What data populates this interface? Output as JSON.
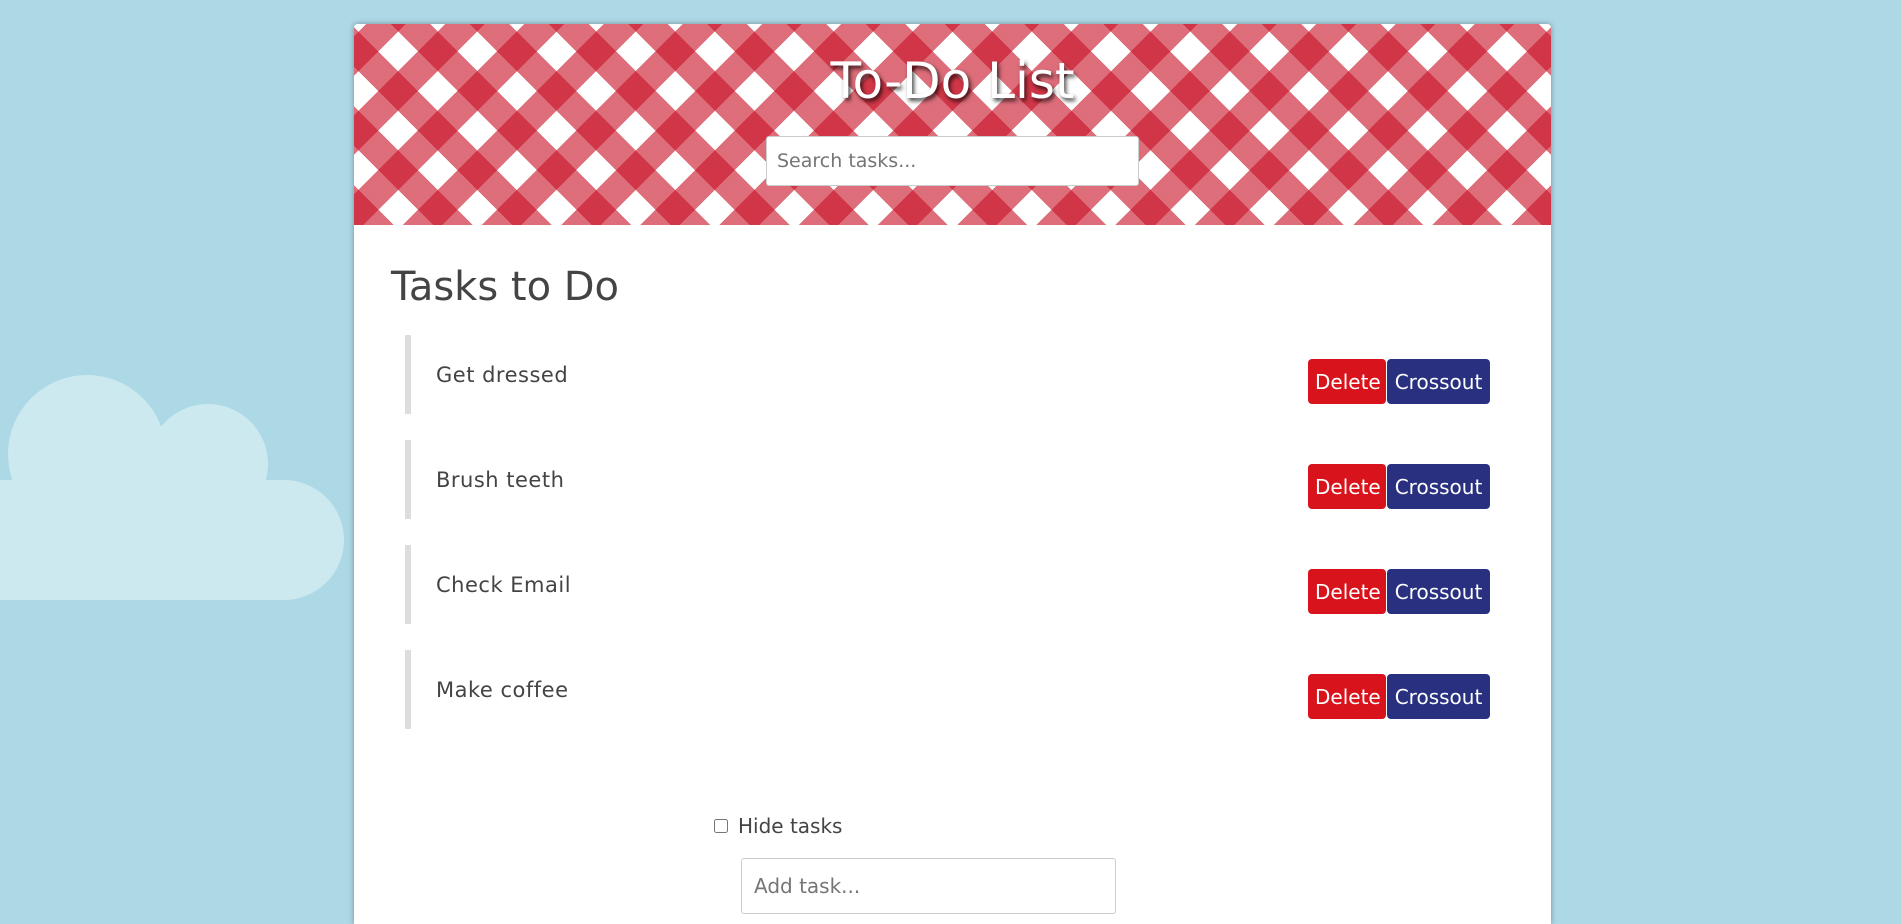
{
  "header": {
    "title": "To-Do List",
    "search_placeholder": "Search tasks..."
  },
  "main": {
    "heading": "Tasks to Do",
    "tasks": [
      {
        "name": "Get dressed",
        "delete_label": "Delete",
        "crossout_label": "Crossout"
      },
      {
        "name": "Brush teeth",
        "delete_label": "Delete",
        "crossout_label": "Crossout"
      },
      {
        "name": "Check Email",
        "delete_label": "Delete",
        "crossout_label": "Crossout"
      },
      {
        "name": "Make coffee",
        "delete_label": "Delete",
        "crossout_label": "Crossout"
      }
    ],
    "hide_tasks_label": "Hide tasks",
    "hide_tasks_checked": false,
    "add_task_placeholder": "Add task..."
  },
  "colors": {
    "background": "#add8e6",
    "banner_check": "#c8142a",
    "delete_button": "#d8131b",
    "crossout_button": "#28307f"
  }
}
